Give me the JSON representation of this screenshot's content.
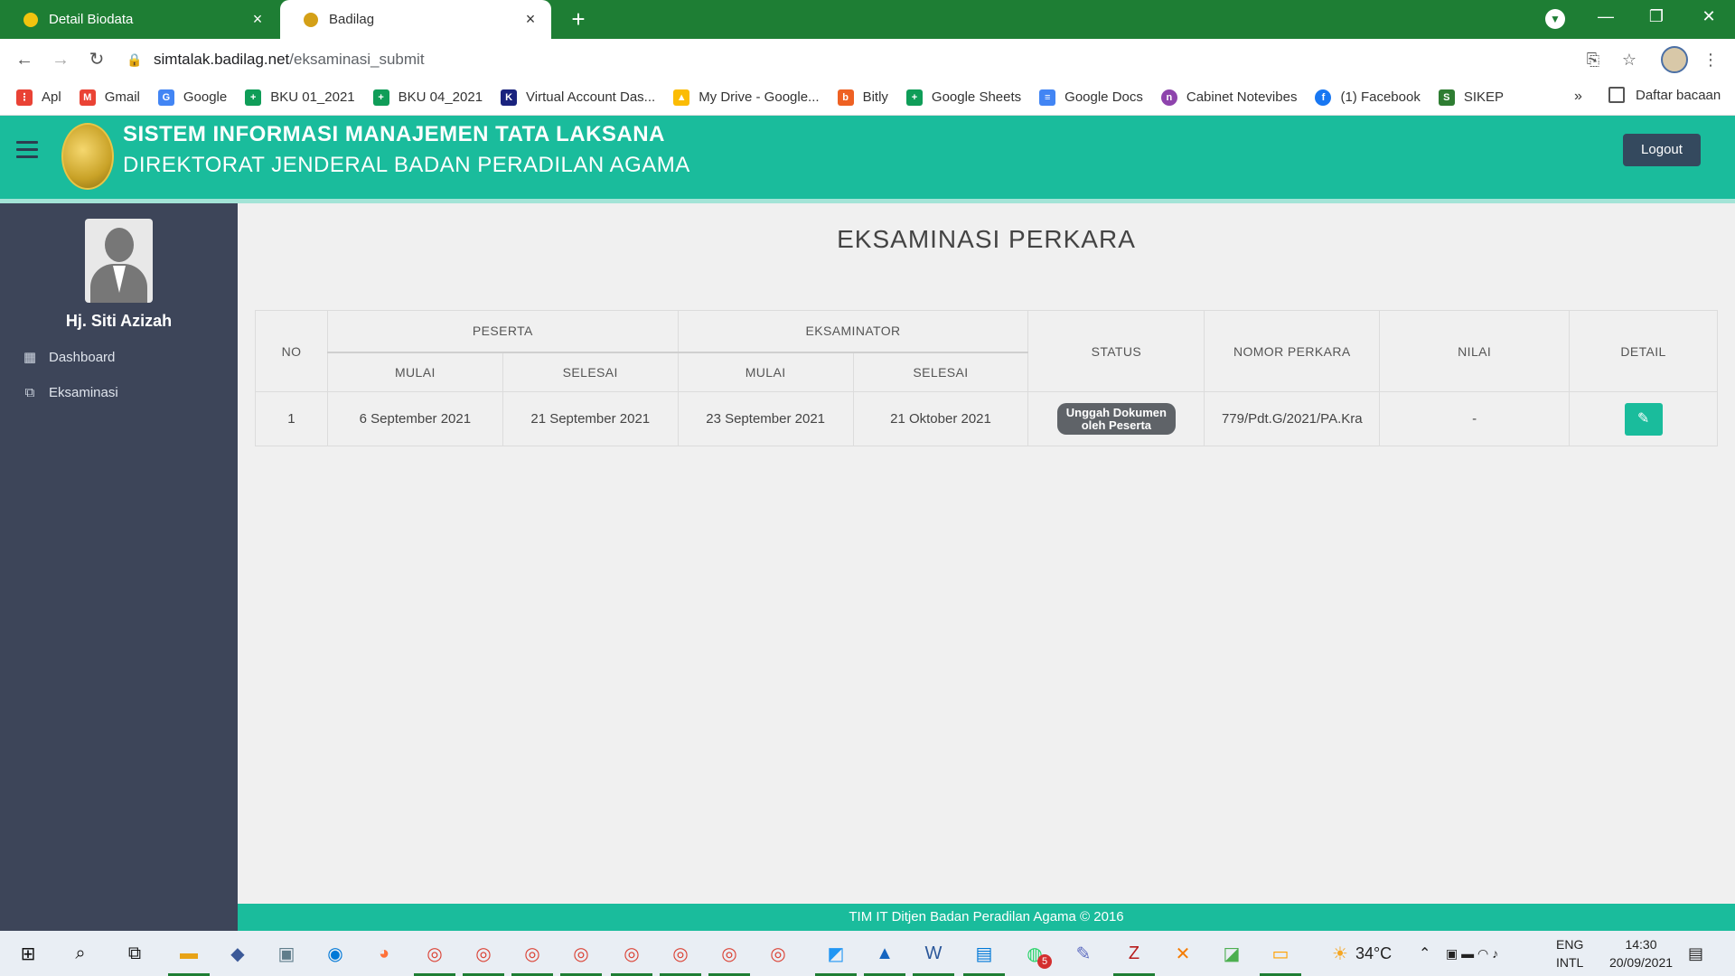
{
  "browser": {
    "tabs": [
      {
        "title": "Detail Biodata",
        "close": "×"
      },
      {
        "title": "Badilag",
        "close": "×"
      }
    ],
    "new_tab": "+",
    "window_controls": {
      "minimize": "—",
      "restore": "❐",
      "close": "✕"
    },
    "url_host": "simtalak.badilag.net",
    "url_path": "/eksaminasi_submit",
    "bookmarks": [
      {
        "label": "Apl",
        "icon": "apps-grid-icon",
        "color": "#e94235"
      },
      {
        "label": "Gmail",
        "icon": "gmail-icon",
        "color": "#ea4335"
      },
      {
        "label": "Google",
        "icon": "google-icon",
        "color": "#4285f4"
      },
      {
        "label": "BKU 01_2021",
        "icon": "sheets-icon",
        "color": "#0f9d58"
      },
      {
        "label": "BKU 04_2021",
        "icon": "sheets-icon",
        "color": "#0f9d58"
      },
      {
        "label": "Virtual Account Das...",
        "icon": "va-icon",
        "color": "#1a237e"
      },
      {
        "label": "My Drive - Google...",
        "icon": "drive-icon",
        "color": "#fbbc04"
      },
      {
        "label": "Bitly",
        "icon": "bitly-icon",
        "color": "#ee6123"
      },
      {
        "label": "Google Sheets",
        "icon": "sheets-icon",
        "color": "#0f9d58"
      },
      {
        "label": "Google Docs",
        "icon": "docs-icon",
        "color": "#4285f4"
      },
      {
        "label": "Cabinet Notevibes",
        "icon": "notevibes-icon",
        "color": "#8e44ad"
      },
      {
        "label": "(1) Facebook",
        "icon": "facebook-icon",
        "color": "#1877f2"
      },
      {
        "label": "SIKEP",
        "icon": "sikep-icon",
        "color": "#2e7d32"
      }
    ],
    "bookmarks_more": "»",
    "reading_list": "Daftar bacaan"
  },
  "header": {
    "title_line1": "SISTEM INFORMASI MANAJEMEN TATA LAKSANA",
    "title_line2": "DIREKTORAT JENDERAL BADAN PERADILAN AGAMA",
    "logout_label": "Logout"
  },
  "sidebar": {
    "user_name": "Hj. Siti Azizah",
    "items": [
      {
        "label": "Dashboard",
        "icon": "grid-icon"
      },
      {
        "label": "Eksaminasi",
        "icon": "copy-icon"
      }
    ]
  },
  "main": {
    "page_title": "EKSAMINASI PERKARA",
    "table": {
      "headers": {
        "no": "NO",
        "peserta": "PESERTA",
        "eksaminator": "EKSAMINATOR",
        "mulai": "MULAI",
        "selesai": "SELESAI",
        "status": "STATUS",
        "nomor_perkara": "NOMOR PERKARA",
        "nilai": "NILAI",
        "detail": "DETAIL"
      },
      "rows": [
        {
          "no": "1",
          "peserta_mulai": "6 September 2021",
          "peserta_selesai": "21 September 2021",
          "eksaminator_mulai": "23 September 2021",
          "eksaminator_selesai": "21 Oktober 2021",
          "status_line1": "Unggah Dokumen",
          "status_line2": "oleh Peserta",
          "nomor_perkara": "779/Pdt.G/2021/PA.Kra",
          "nilai": "-",
          "detail_icon": "edit-icon"
        }
      ]
    }
  },
  "footer": {
    "text": "TIM IT Ditjen Badan Peradilan Agama © 2016"
  },
  "taskbar": {
    "temperature": "34°C",
    "lang_line1": "ENG",
    "lang_line2": "INTL",
    "time": "14:30",
    "date": "20/09/2021",
    "whatsapp_badge": "5"
  },
  "colors": {
    "accent": "#1abc9c",
    "sidebar": "#3d4559",
    "browser_frame": "#1e7e34",
    "logout_button": "#34495e",
    "status_badge": "#5f6368"
  }
}
